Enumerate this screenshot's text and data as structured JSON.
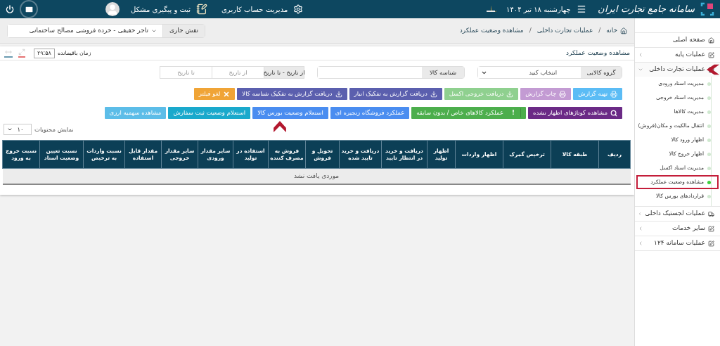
{
  "header": {
    "logo_text": "سامانه جامع تجارت ایران",
    "date": "چهارشنبه ۱۸ تیر ۱۴۰۴",
    "account_link": "مدیریت حساب کاربری",
    "support_link": "ثبت و پیگیری مشکل"
  },
  "role": {
    "label": "نقش جاری",
    "value": "تاجر حقیقی - خرده فروشی مصالح ساختمانی"
  },
  "breadcrumb": [
    {
      "kind": "link",
      "label": "خانه"
    },
    {
      "kind": "separator",
      "label": "/"
    },
    {
      "kind": "link",
      "label": "عملیات تجارت داخلی"
    },
    {
      "kind": "separator",
      "label": "/"
    },
    {
      "kind": "current",
      "label": "مشاهده وضعیت عملکرد"
    }
  ],
  "panel_title": "مشاهده وضعیت عملکرد",
  "timer": {
    "label": "زمان باقیمانده",
    "value": "۲۹:۵۸"
  },
  "filters": [
    {
      "kind": "select",
      "label": "گروه کالایی",
      "value": "انتخاب کنید"
    },
    {
      "kind": "text",
      "label": "شناسه کالا"
    },
    {
      "kind": "daterange",
      "label": "از تاریخ - تا تاریخ",
      "from_placeholder": "از تاریخ",
      "to_placeholder": "تا تاریخ"
    }
  ],
  "toolbar_rows": [
    [
      {
        "label": "تهیه گزارش",
        "kind": "print",
        "color": "#5bbcf5"
      },
      {
        "label": "چاپ گزارش",
        "kind": "print",
        "color": "#c39bd3"
      },
      {
        "label": "دریافت خروجی اکسل",
        "kind": "download",
        "color": "#8fd08f"
      },
      {
        "label": "دریافت گزارش به تفکیک انبار",
        "kind": "download",
        "color": "#5b5fae"
      },
      {
        "label": "دریافت گزارش به تفکیک شناسه کالا",
        "kind": "download",
        "color": "#5b5fae"
      },
      {
        "label": "لغو فیلتر",
        "kind": "clear",
        "color": "#f0a436"
      }
    ],
    [
      {
        "label": "مشاهده کوتاژهای اظهار نشده",
        "kind": "search",
        "color": "#6b2a86"
      },
      {
        "label": "عملکرد کالاهای خاص / بدون سابقه",
        "kind": "flag",
        "badge": "!",
        "color": "#4cae4c"
      },
      {
        "label": "عملکرد فروشگاه زنجیره ای",
        "kind": "plain",
        "color": "#4a8df0"
      },
      {
        "label": "استعلام وضعیت بورس کالا",
        "kind": "plain",
        "color": "#4a8df0"
      },
      {
        "label": "استعلام وضعیت ثبت سفارش",
        "kind": "plain",
        "color": "#1aa9cc"
      },
      {
        "label": "مشاهده سهمیه ارزی",
        "kind": "plain",
        "color": "#5cbde8"
      }
    ]
  ],
  "page_size": {
    "label": "نمایش محتویات",
    "value": "۱۰"
  },
  "table": {
    "columns": [
      "ردیف",
      "طبقه کالا",
      "ترخیص گمرک",
      "اظهار واردات",
      "اظهار تولید",
      "دریافت و خرید در انتظار تایید",
      "دریافت و خرید تایید شده",
      "تحویل و فروش",
      "فروش به مصرف کننده",
      "استفاده در تولید",
      "سایر مقدار ورودی",
      "سایر مقدار خروجی",
      "مقدار قابل استفاده",
      "نسبت واردات به ترخیص",
      "نسبت تعیین وضعیت اسناد",
      "نسبت خروج به ورود"
    ],
    "empty_message": "موردی یافت نشد"
  },
  "sidebar": {
    "items": [
      {
        "label": "صفحه اصلی"
      },
      {
        "label": "عملیات پایه",
        "expanded": false
      },
      {
        "label": "عملیات تجارت داخلی",
        "expanded": true,
        "children": [
          {
            "label": "مدیریت اسناد ورودی",
            "selected": false
          },
          {
            "label": "مدیریت اسناد خروجی",
            "selected": false
          },
          {
            "label": "مدیریت کالاها",
            "selected": false
          },
          {
            "label": "انتقال مالکیت و مکان(فروش)",
            "selected": false
          },
          {
            "label": "اظهار ورود کالا",
            "selected": false
          },
          {
            "label": "اظهار خروج کالا",
            "selected": false
          },
          {
            "label": "مدیریت اسناد اکسل",
            "selected": false
          },
          {
            "label": "مشاهده وضعیت عملکرد",
            "selected": true
          },
          {
            "label": "قراردادهای بورس کالا",
            "selected": false
          }
        ]
      },
      {
        "label": "عملیات لجستیک داخلی",
        "expanded": false
      },
      {
        "label": "سایر خدمات",
        "expanded": false
      },
      {
        "label": "عملیات سامانه ۱۲۴",
        "expanded": false
      }
    ]
  }
}
